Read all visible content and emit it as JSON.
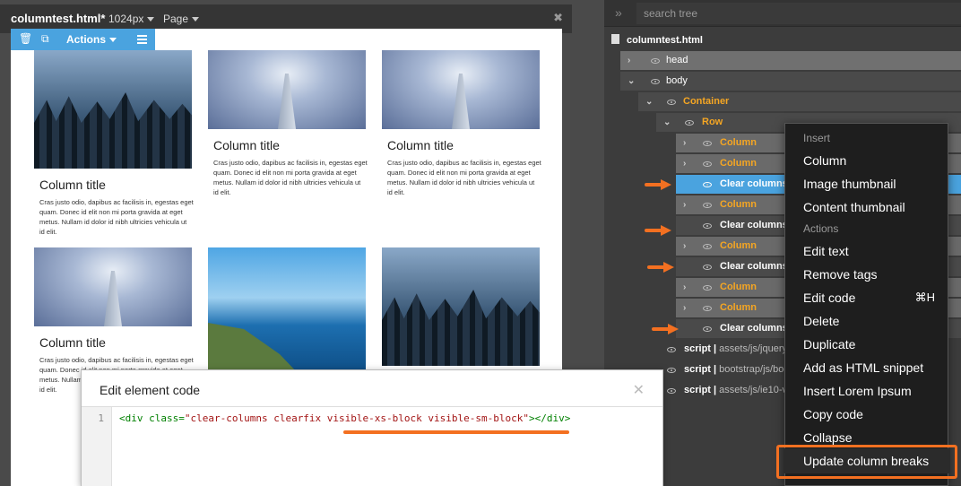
{
  "editor": {
    "file": "columntest.html*",
    "viewport": "1024px",
    "page": "Page",
    "toolbar": {
      "actions": "Actions"
    }
  },
  "columns": [
    {
      "title": "Column title",
      "text": "Cras justo odio, dapibus ac facilisis in, egestas eget quam. Donec id elit non mi porta gravida at eget metus. Nullam id dolor id nibh ultricies vehicula ut id elit."
    },
    {
      "title": "Column title",
      "text": "Cras justo odio, dapibus ac facilisis in, egestas eget quam. Donec id elit non mi porta gravida at eget metus. Nullam id dolor id nibh ultricies vehicula ut id elit."
    },
    {
      "title": "Column title",
      "text": "Cras justo odio, dapibus ac facilisis in, egestas eget quam. Donec id elit non mi porta gravida at eget metus. Nullam id dolor id nibh ultricies vehicula ut id elit."
    },
    {
      "title": "Column title",
      "text": "Cras justo odio, dapibus ac facilisis in, egestas eget quam. Donec id elit non mi porta gravida at eget metus. Nullam id dolor id nibh ultricies vehicula ut id elit."
    }
  ],
  "dialog": {
    "title": "Edit element code",
    "line_number": "1",
    "code_prefix": "<div class=",
    "code_string": "\"clear-columns clearfix visible-xs-block visible-sm-block\"",
    "code_suffix": "></div>"
  },
  "tree": {
    "search_placeholder": "search tree",
    "file": "columntest.html",
    "nodes": {
      "head": "head",
      "body": "body",
      "container": "Container",
      "row": "Row",
      "column": "Column",
      "clear": "Clear columns",
      "script_label": "script",
      "script1": "assets/js/jquery",
      "script2": "bootstrap/js/boo",
      "script3": "assets/js/ie10-v"
    }
  },
  "context_menu": {
    "insert_header": "Insert",
    "insert_items": [
      "Column",
      "Image thumbnail",
      "Content thumbnail"
    ],
    "actions_header": "Actions",
    "action_items": [
      "Edit text",
      "Remove tags",
      "Edit code",
      "Delete",
      "Duplicate",
      "Add as HTML snippet",
      "Insert Lorem Ipsum",
      "Copy code",
      "Collapse",
      "Update column breaks"
    ],
    "edit_code_shortcut": "⌘H"
  }
}
